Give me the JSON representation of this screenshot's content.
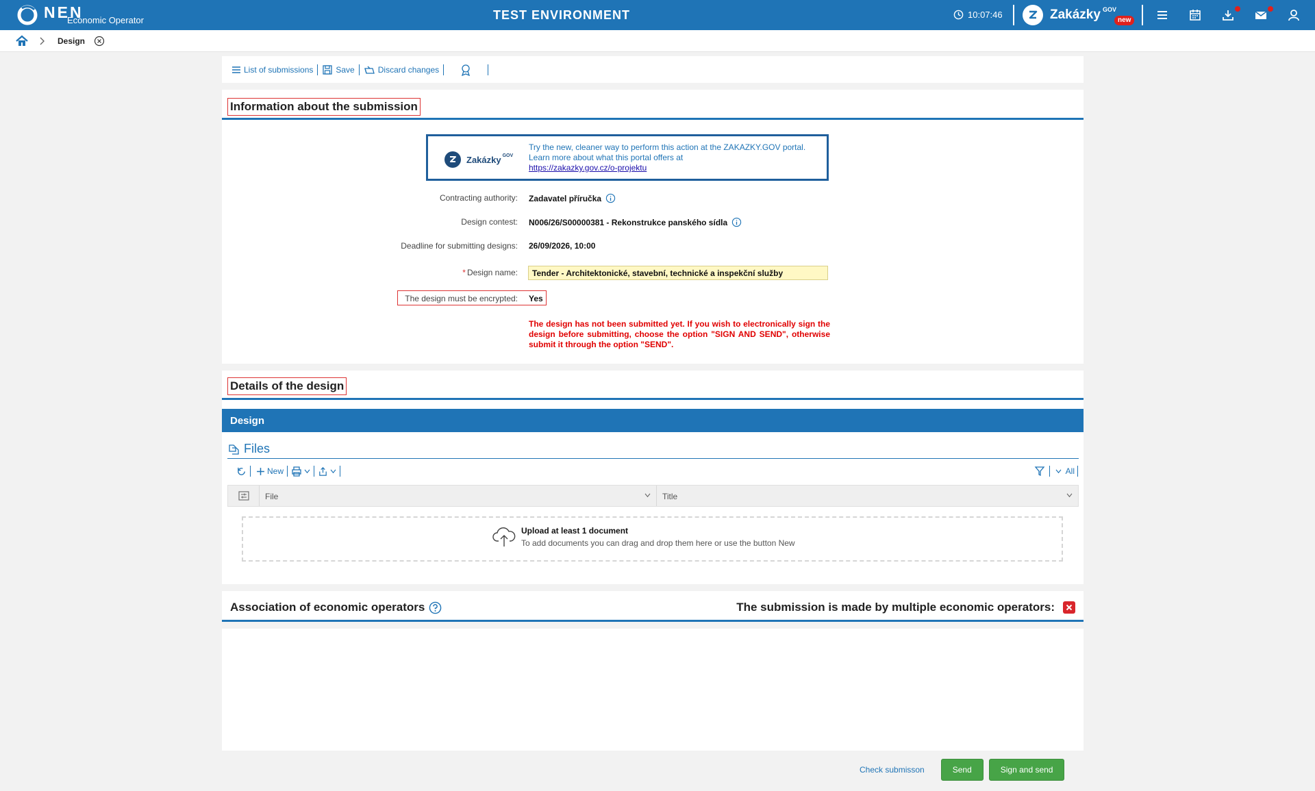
{
  "header": {
    "logo": "NEN",
    "logo_sub": "Economic Operator",
    "environment": "TEST ENVIRONMENT",
    "clock": "10:07:46",
    "portal_name": "Zakázky",
    "portal_sup": "GOV",
    "portal_badge": "new"
  },
  "breadcrumb": {
    "current": "Design"
  },
  "toolbar": {
    "list": "List of submissions",
    "save": "Save",
    "discard": "Discard changes"
  },
  "info": {
    "title": "Information about the submission",
    "banner": {
      "brand": "Zakázky",
      "brand_sup": "GOV",
      "line1": "Try the new, cleaner way to perform this action at the ZAKAZKY.GOV portal.",
      "line2": "Learn more about what this portal offers at",
      "link": "https://zakazky.gov.cz/o-projektu"
    },
    "fields": {
      "authority_label": "Contracting authority:",
      "authority_value": "Zadavatel příručka",
      "contest_label": "Design contest:",
      "contest_value": "N006/26/S00000381 - Rekonstrukce panského sídla",
      "deadline_label": "Deadline for submitting designs:",
      "deadline_value": "26/09/2026, 10:00",
      "name_label": "Design name:",
      "name_value": "Tender - Architektonické, stavební, technické a inspekční služby",
      "encrypted_label": "The design must be encrypted:",
      "encrypted_value": "Yes"
    },
    "warning": "The design has not been submitted yet. If you wish to electronically sign the design before submitting, choose the option \"SIGN AND SEND\", otherwise submit it through the option \"SEND\"."
  },
  "details": {
    "title": "Details of the design",
    "bar": "Design",
    "files_title": "Files",
    "new": "New",
    "all": "All",
    "columns": [
      "File",
      "Title"
    ],
    "upload_title": "Upload at least 1 document",
    "upload_sub": "To add documents you can drag and drop them here or use the button New"
  },
  "association": {
    "title": "Association of economic operators",
    "multiple": "The submission is made by multiple economic operators:"
  },
  "actions": {
    "check": "Check submisson",
    "send": "Send",
    "sign_send": "Sign and send"
  },
  "colors": {
    "primary": "#1f74b6",
    "danger": "#e00000",
    "success": "#47a447",
    "input_highlight": "#fff8c4"
  }
}
